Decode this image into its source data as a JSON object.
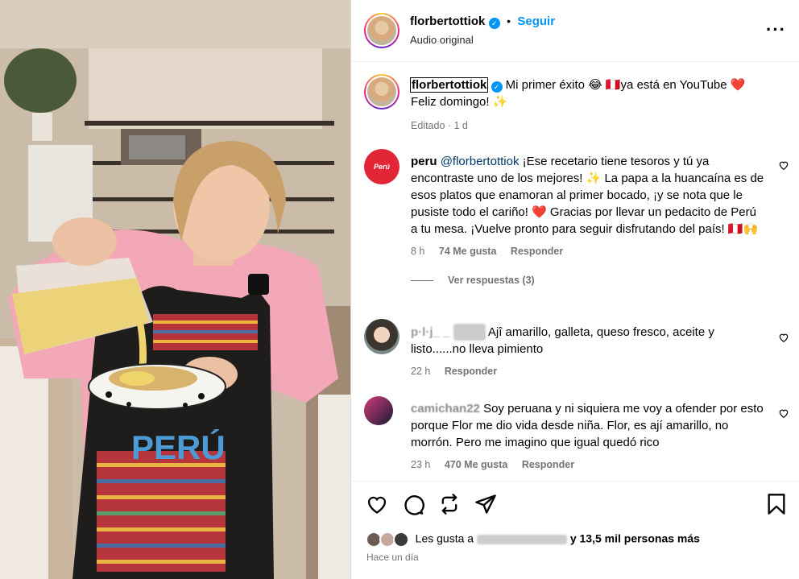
{
  "post": {
    "username": "florbertottiok",
    "follow_label": "Seguir",
    "audio": "Audio original",
    "more_icon": "more-horizontal-icon"
  },
  "caption": {
    "username": "florbertottiok",
    "line1": "Mi primer éxito 😂 🇵🇪ya está en YouTube ❤️",
    "line2": "Feliz domingo! ✨",
    "meta": "Editado · 1 d"
  },
  "comments": [
    {
      "username": "peru",
      "mention": "@florbertottiok",
      "text": " ¡Ese recetario tiene tesoros y tú ya encontraste uno de los mejores! ✨ La papa a la huancaína es de esos platos que enamoran al primer bocado, ¡y se nota que le pusiste todo el cariño! ❤️ Gracias por llevar un pedacito de Perú a tu mesa. ¡Vuelve pronto para seguir disfrutando del país! 🇵🇪🙌",
      "time": "8 h",
      "likes": "74 Me gusta",
      "reply": "Responder",
      "view_replies": "Ver respuestas (3)"
    },
    {
      "username": "p·l·j_ _",
      "text": "Ajî amarillo, galleta, queso fresco, aceite y listo......no lleva pimiento",
      "time": "22 h",
      "reply": "Responder"
    },
    {
      "username": "camichan22",
      "text": "Soy peruana y ni siquiera me voy a ofender por esto porque Flor me dio vida desde niña. Flor, es ají amarillo, no morrón. Pero me imagino que igual quedó rico",
      "time": "23 h",
      "likes": "470 Me gusta",
      "reply": "Responder"
    }
  ],
  "footer": {
    "likes_prefix": "Les gusta a",
    "likes_suffix": "y 13,5 mil personas más",
    "time_ago": "Hace un día"
  },
  "photo": {
    "apron_text": "PERÚ"
  },
  "colors": {
    "accent": "#0095f6",
    "muted": "#737373",
    "heart": "#ed4956"
  }
}
